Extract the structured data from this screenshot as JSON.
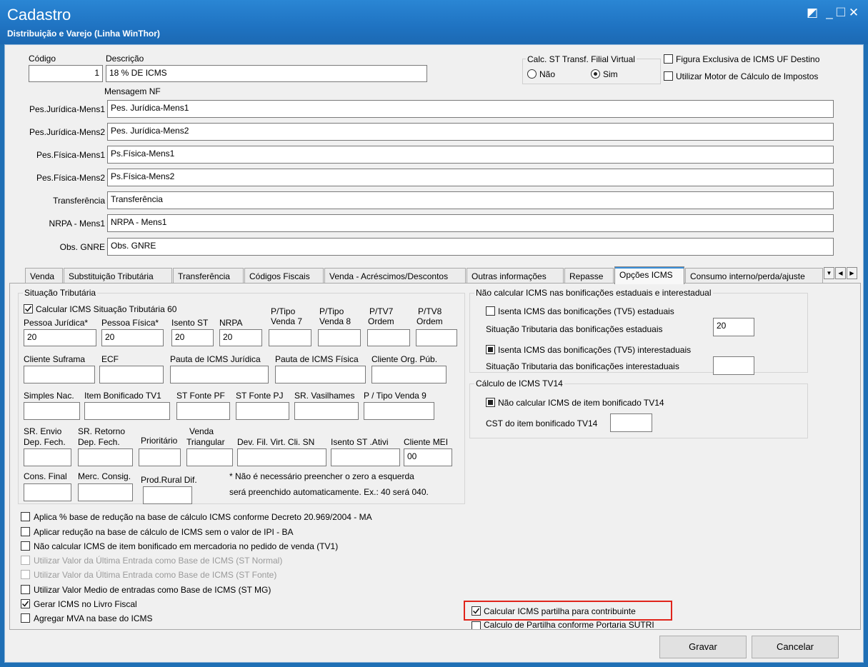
{
  "window": {
    "title": "Cadastro",
    "subtitle": "Distribuição e Varejo (Linha WinThor)",
    "restore_glyph": "◩",
    "minimize_glyph": "_",
    "maximize_glyph": "☐",
    "close_glyph": "✕"
  },
  "header": {
    "codigo_label": "Código",
    "codigo_value": "1",
    "descricao_label": "Descrição",
    "descricao_value": "18 % DE ICMS",
    "calc_st_title": "Calc. ST Transf. Filial Virtual",
    "radio_nao": "Não",
    "radio_sim": "Sim",
    "radio_selected": "Sim",
    "figura_exclusiva": "Figura Exclusiva de ICMS UF Destino",
    "utilizar_motor": "Utilizar Motor de Cálculo de Impostos",
    "mensagem_nf": "Mensagem NF"
  },
  "mensagens": [
    {
      "label": "Pes.Jurídica-Mens1",
      "value": "Pes. Jurídica-Mens1"
    },
    {
      "label": "Pes.Jurídica-Mens2",
      "value": "Pes. Jurídica-Mens2"
    },
    {
      "label": "Pes.Física-Mens1",
      "value": "Ps.Física-Mens1"
    },
    {
      "label": "Pes.Física-Mens2",
      "value": "Ps.Física-Mens2"
    },
    {
      "label": "Transferência",
      "value": "Transferência"
    },
    {
      "label": "NRPA - Mens1",
      "value": "NRPA - Mens1"
    },
    {
      "label": "Obs. GNRE",
      "value": "Obs. GNRE"
    }
  ],
  "tabs": [
    {
      "label": "Venda"
    },
    {
      "label": "Substituição Tributária"
    },
    {
      "label": "Transferência"
    },
    {
      "label": "Códigos Fiscais"
    },
    {
      "label": "Venda - Acréscimos/Descontos"
    },
    {
      "label": "Outras informações"
    },
    {
      "label": "Repasse"
    },
    {
      "label": "Opções ICMS",
      "active": true
    },
    {
      "label": "Consumo interno/perda/ajuste"
    }
  ],
  "tab_scroll": {
    "dropdown": "▼",
    "left": "◀",
    "right": "▶"
  },
  "situacao": {
    "title": "Situação Tributária",
    "calc_icms_st60": "Calcular ICMS Situação Tributária 60",
    "pessoa_juridica_label": "Pessoa Jurídica*",
    "pessoa_juridica_value": "20",
    "pessoa_fisica_label": "Pessoa Física*",
    "pessoa_fisica_value": "20",
    "isento_st_label": "Isento ST",
    "isento_st_value": "20",
    "nrpa_label": "NRPA",
    "nrpa_value": "20",
    "ptipo_venda7_l1": "P/Tipo",
    "ptipo_venda7_l2": "Venda 7",
    "ptipo_venda8_l1": "P/Tipo",
    "ptipo_venda8_l2": "Venda 8",
    "ptv7_l1": "P/TV7",
    "ptv7_l2": "Ordem",
    "ptv8_l1": "P/TV8",
    "ptv8_l2": "Ordem",
    "cliente_suframa": "Cliente Suframa",
    "ecf": "ECF",
    "pauta_juridica": "Pauta de ICMS Jurídica",
    "pauta_fisica": "Pauta de ICMS Física",
    "cliente_org_pub": "Cliente Org. Púb.",
    "simples_nac": "Simples Nac.",
    "item_bonificado_tv1": "Item Bonificado TV1",
    "st_fonte_pf": "ST Fonte PF",
    "st_fonte_pj": "ST Fonte PJ",
    "sr_vasilhames": "SR. Vasilhames",
    "p_tipo_venda9": "P / Tipo Venda 9",
    "sr_envio_l1": "SR. Envio",
    "sr_envio_l2": "Dep. Fech.",
    "sr_retorno_l1": "SR. Retorno",
    "sr_retorno_l2": "Dep. Fech.",
    "prioritario": "Prioritário",
    "venda_triangular_l1": "Venda",
    "venda_triangular_l2": "Triangular",
    "dev_fil_virt": "Dev. Fil. Virt. Cli. SN",
    "isento_st_ativi": "Isento ST .Ativi",
    "cliente_mei": "Cliente MEI",
    "cliente_mei_value": "00",
    "cons_final": "Cons. Final",
    "merc_consig": "Merc. Consig.",
    "prod_rural_dif": "Prod.Rural Dif.",
    "note_l1": "* Não é necessário preencher o zero a esquerda",
    "note_l2": "será preenchido automaticamente.  Ex.: 40 será 040."
  },
  "bonificacoes": {
    "title": "Não calcular ICMS nas bonificações estaduais e interestadual",
    "isenta_estaduais": "Isenta ICMS das bonificações (TV5) estaduais",
    "situacao_estaduais": "Situação Tributaria das  bonificações estaduais",
    "situacao_estaduais_value": "20",
    "isenta_interestaduais": "Isenta ICMS das bonificações (TV5) interestaduais",
    "situacao_interestaduais": "Situação Tributaria das  bonificações interestaduais",
    "situacao_interestaduais_value": ""
  },
  "tv14": {
    "title": "Cálculo de ICMS TV14",
    "nao_calcular": "Não calcular ICMS de item bonificado TV14",
    "cst_label": "CST do item bonificado TV14",
    "cst_value": ""
  },
  "options": [
    {
      "label": "Aplica % base de redução na base de cálculo ICMS conforme Decreto 20.969/2004 - MA",
      "checked": false,
      "disabled": false
    },
    {
      "label": "Aplicar redução na base de cálculo de ICMS sem o valor de IPI - BA",
      "checked": false,
      "disabled": false
    },
    {
      "label": "Não calcular ICMS de item bonificado em mercadoria no pedido de venda (TV1)",
      "checked": false,
      "disabled": false
    },
    {
      "label": "Utilizar Valor da Última Entrada como Base de ICMS (ST Normal)",
      "checked": false,
      "disabled": true
    },
    {
      "label": "Utilizar Valor da Última Entrada como Base de ICMS (ST Fonte)",
      "checked": false,
      "disabled": true
    },
    {
      "label": "Utilizar Valor Medio de entradas como Base de ICMS (ST MG)",
      "checked": false,
      "disabled": false
    },
    {
      "label": "Gerar ICMS no Livro Fiscal",
      "checked": true,
      "disabled": false
    },
    {
      "label": "Agregar MVA na base do ICMS",
      "checked": false,
      "disabled": false
    }
  ],
  "partilha": {
    "calcular": "Calcular ICMS partilha para contribuinte",
    "portaria": "Calculo de Partilha conforme Portaria SUTRI"
  },
  "buttons": {
    "gravar": "Gravar",
    "cancelar": "Cancelar"
  }
}
